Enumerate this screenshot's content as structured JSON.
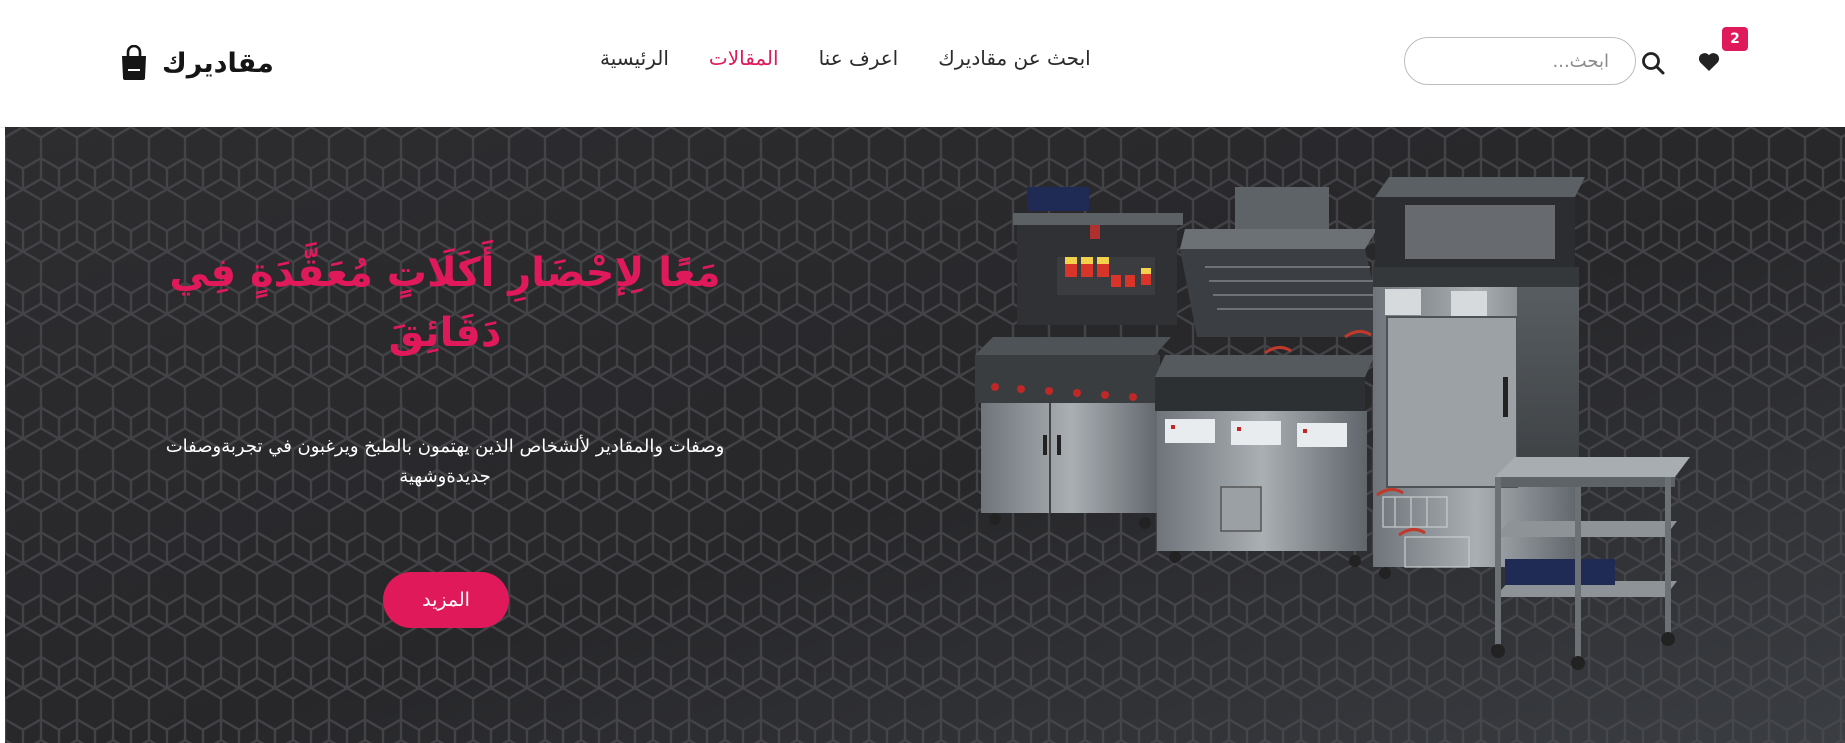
{
  "header": {
    "brand_name": "مقاديرك",
    "nav": [
      {
        "label": "ابحث عن مقاديرك",
        "active": false
      },
      {
        "label": "اعرف عنا",
        "active": false
      },
      {
        "label": "المقالات",
        "active": true
      },
      {
        "label": "الرئيسية",
        "active": false
      }
    ],
    "search": {
      "placeholder": "ابحث...",
      "value": ""
    },
    "favorites_count": "2"
  },
  "hero": {
    "title": "مَعًا لِإحْضَارِ أَكَلَاتٍ مُعَقَّدَةٍ فِي دَقَائِقَ",
    "description": "وصفات والمقادير لألشخاص الذين يهتمون بالطبخ ويرغبون في تجربةوصفات جديدةوشهية",
    "button_label": "المزيد"
  },
  "colors": {
    "accent": "#e0195a",
    "hero_background": "#2a2a2c",
    "header_background": "#ffffff"
  },
  "icons": [
    "shopping-bag-icon",
    "search-icon",
    "heart-icon"
  ]
}
